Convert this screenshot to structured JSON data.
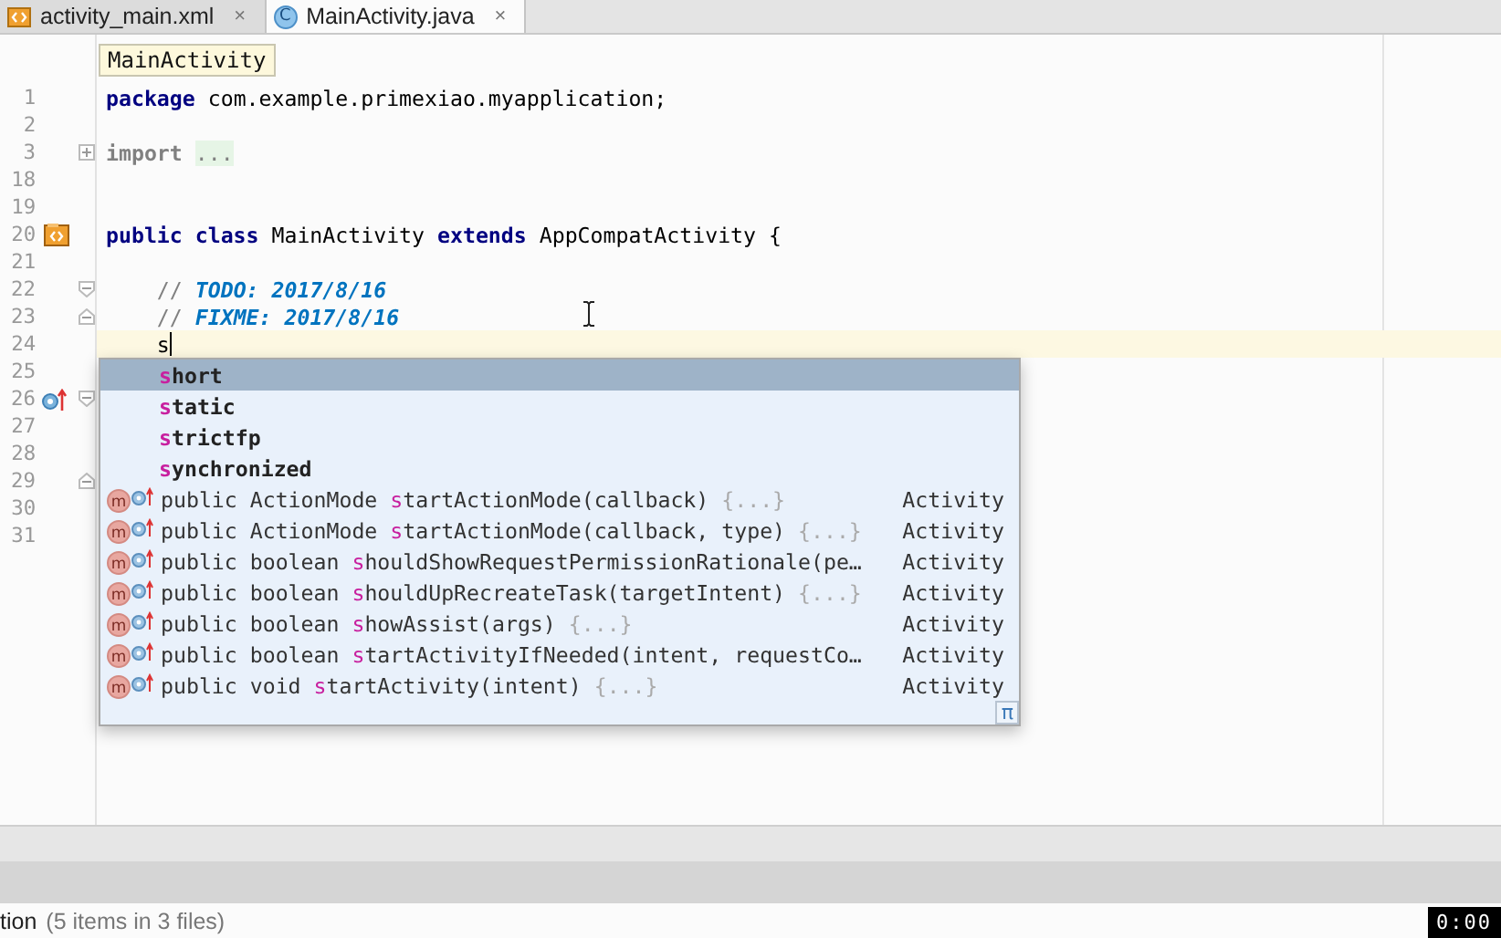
{
  "tabs": [
    {
      "label": "activity_main.xml",
      "kind": "xml",
      "close": "×",
      "selected": false
    },
    {
      "label": "MainActivity.java",
      "kind": "class",
      "icon_letter": "C",
      "close": "×",
      "selected": true
    }
  ],
  "breadcrumb": "MainActivity",
  "lines": [
    {
      "number": "1",
      "tokens": [
        {
          "text": "package",
          "kind": "keyword"
        },
        {
          "text": " com.example.primexiao.myapplication;",
          "kind": "plain"
        }
      ]
    },
    {
      "number": "2"
    },
    {
      "number": "3",
      "fold": {
        "kind": "collapsed"
      },
      "tokens": [
        {
          "text": "import ",
          "kind": "folded_keyword"
        },
        {
          "text": "...",
          "kind": "fold_placeholder"
        }
      ]
    },
    {
      "number": "18"
    },
    {
      "number": "19"
    },
    {
      "number": "20",
      "gutter": {
        "kind": "class"
      },
      "tokens": [
        {
          "text": "public class",
          "kind": "keyword"
        },
        {
          "text": " MainActivity ",
          "kind": "plain"
        },
        {
          "text": "extends",
          "kind": "keyword"
        },
        {
          "text": " AppCompatActivity {",
          "kind": "plain"
        }
      ]
    },
    {
      "number": "21"
    },
    {
      "number": "22",
      "fold": {
        "kind": "start"
      },
      "tokens": [
        {
          "text": "    // ",
          "kind": "comment"
        },
        {
          "text": "TODO: 2017/8/16",
          "kind": "todo"
        }
      ]
    },
    {
      "number": "23",
      "fold": {
        "kind": "end"
      },
      "tokens": [
        {
          "text": "    // ",
          "kind": "comment"
        },
        {
          "text": "FIXME: 2017/8/16",
          "kind": "todo"
        }
      ]
    },
    {
      "number": "24",
      "current": true,
      "caret": true,
      "tokens": [
        {
          "text": "    s",
          "kind": "plain"
        }
      ]
    },
    {
      "number": "25"
    },
    {
      "number": "26",
      "gutter": {
        "kind": "override"
      },
      "fold": {
        "kind": "start"
      }
    },
    {
      "number": "27"
    },
    {
      "number": "28"
    },
    {
      "number": "29",
      "fold": {
        "kind": "end"
      }
    },
    {
      "number": "30"
    },
    {
      "number": "31"
    }
  ],
  "completion": {
    "footer_icon": "π",
    "items": [
      {
        "kind": "keyword",
        "match": "s",
        "rest": "hort",
        "selected": true
      },
      {
        "kind": "keyword",
        "match": "s",
        "rest": "tatic",
        "selected": false
      },
      {
        "kind": "keyword",
        "match": "s",
        "rest": "trictfp",
        "selected": false
      },
      {
        "kind": "keyword",
        "match": "s",
        "rest": "ynchronized",
        "selected": false
      },
      {
        "kind": "method",
        "icon_letter": "m",
        "before": "public ActionMode ",
        "match": "s",
        "rest": "tartActionMode(callback) ",
        "body": "{...}",
        "type": "Activity",
        "selected": false
      },
      {
        "kind": "method",
        "icon_letter": "m",
        "before": "public ActionMode ",
        "match": "s",
        "rest": "tartActionMode(callback, type) ",
        "body": "{...}",
        "type": "Activity",
        "selected": false
      },
      {
        "kind": "method",
        "icon_letter": "m",
        "before": "public boolean ",
        "match": "s",
        "rest": "houldShowRequestPermissionRationale(pe…",
        "type": "Activity",
        "selected": false
      },
      {
        "kind": "method",
        "icon_letter": "m",
        "before": "public boolean ",
        "match": "s",
        "rest": "houldUpRecreateTask(targetIntent) ",
        "body": "{...}",
        "type": "Activity",
        "selected": false
      },
      {
        "kind": "method",
        "icon_letter": "m",
        "before": "public boolean ",
        "match": "s",
        "rest": "howAssist(args) ",
        "body": "{...}",
        "type": "Activity",
        "selected": false
      },
      {
        "kind": "method",
        "icon_letter": "m",
        "before": "public boolean ",
        "match": "s",
        "rest": "tartActivityIfNeeded(intent, requestCo…",
        "type": "Activity",
        "selected": false
      },
      {
        "kind": "method",
        "icon_letter": "m",
        "before": "public void ",
        "match": "s",
        "rest": "tartActivity(intent) ",
        "body": "{...}",
        "type": "Activity",
        "selected": false
      }
    ]
  },
  "status": {
    "label": "tion",
    "detail": "(5 items in 3 files)"
  },
  "timer": "0:00"
}
